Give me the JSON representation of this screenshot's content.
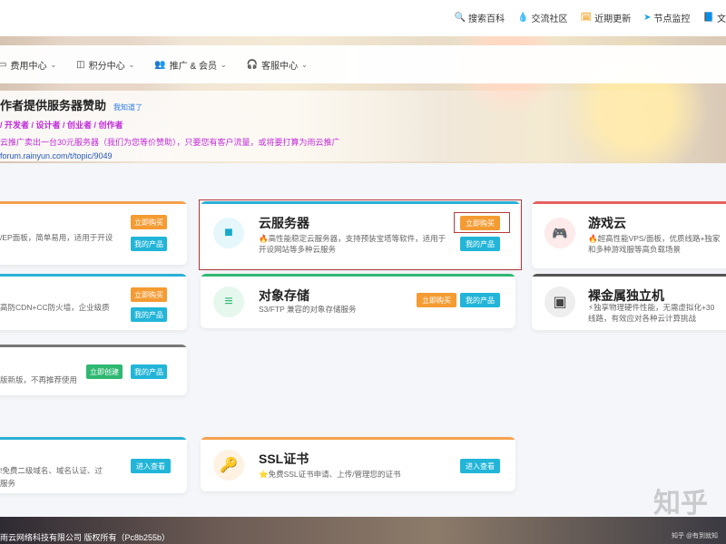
{
  "top_links": [
    {
      "icon": "search-icon",
      "glyph": "🔍",
      "label": "搜索百科"
    },
    {
      "icon": "chat-icon",
      "glyph": "💧",
      "label": "交流社区"
    },
    {
      "icon": "update-icon",
      "glyph": "🗓",
      "label": "近期更新"
    },
    {
      "icon": "monitor-icon",
      "glyph": "➤",
      "label": "节点监控"
    },
    {
      "icon": "doc-icon",
      "glyph": "📘",
      "label": "文"
    }
  ],
  "nav": [
    {
      "glyph": "▭",
      "label": "费用中心"
    },
    {
      "glyph": "◫",
      "label": "积分中心"
    },
    {
      "glyph": "👥",
      "label": "推广 & 会员"
    },
    {
      "glyph": "🎧",
      "label": "客服中心"
    }
  ],
  "notice": {
    "title": "作者提供服务器赞助",
    "tag": "我知道了",
    "roles": "/ 开发者 / 设计者 / 创业者 / 创作者",
    "line": "云推广卖出一台30元服务器（我们为您等价赞助），只要您有客户流量，或将要打算为雨云推广",
    "url": "forum.rainyun.com/t/topic/9049"
  },
  "cards": {
    "a1": {
      "desc": "/EP面板，简单易用，适用于开设",
      "btn1": "立即购买",
      "btn2": "我的产品"
    },
    "a2": {
      "desc": "高防CDN+CC防火墙，企业级质",
      "btn1": "立即购买",
      "btn2": "我的产品"
    },
    "a3": {
      "desc": "版新版，不再推荐使用",
      "btn1": "立即创建",
      "btn2": "我的产品"
    },
    "a4": {
      "desc1": "!免费二级域名、域名认证、过",
      "desc2": "服务",
      "btn1": "进入查看"
    },
    "cloud": {
      "title": "云服务器",
      "desc1": "🔥高性能稳定云服务器，支持预装宝塔等软件，适用于",
      "desc2": "开设网站等多种云服务",
      "btn1": "立即购买",
      "btn2": "我的产品"
    },
    "storage": {
      "title": "对象存储",
      "desc1": "S3/FTP 兼容的对象存储服务",
      "btn1": "立即购买",
      "btn2": "我的产品"
    },
    "ssl": {
      "title": "SSL证书",
      "desc1": "⭐免费SSL证书申请、上传/管理您的证书",
      "btn1": "进入查看"
    },
    "game": {
      "title": "游戏云",
      "desc1": "🔥超高性能VPS/面板，优质线路+独家",
      "desc2": "和多种游戏服等高负载场景"
    },
    "bare": {
      "title": "裸金属独立机",
      "desc1": "⚡独享物理硬件性能，无需虚拟化+30",
      "desc2": "线路，有效应对各种云计算挑战"
    }
  },
  "footer": "雨云网络科技有限公司 版权所有（Pc8b255b）",
  "watermark": "知乎",
  "watermark_small": "知乎 @有到就知"
}
